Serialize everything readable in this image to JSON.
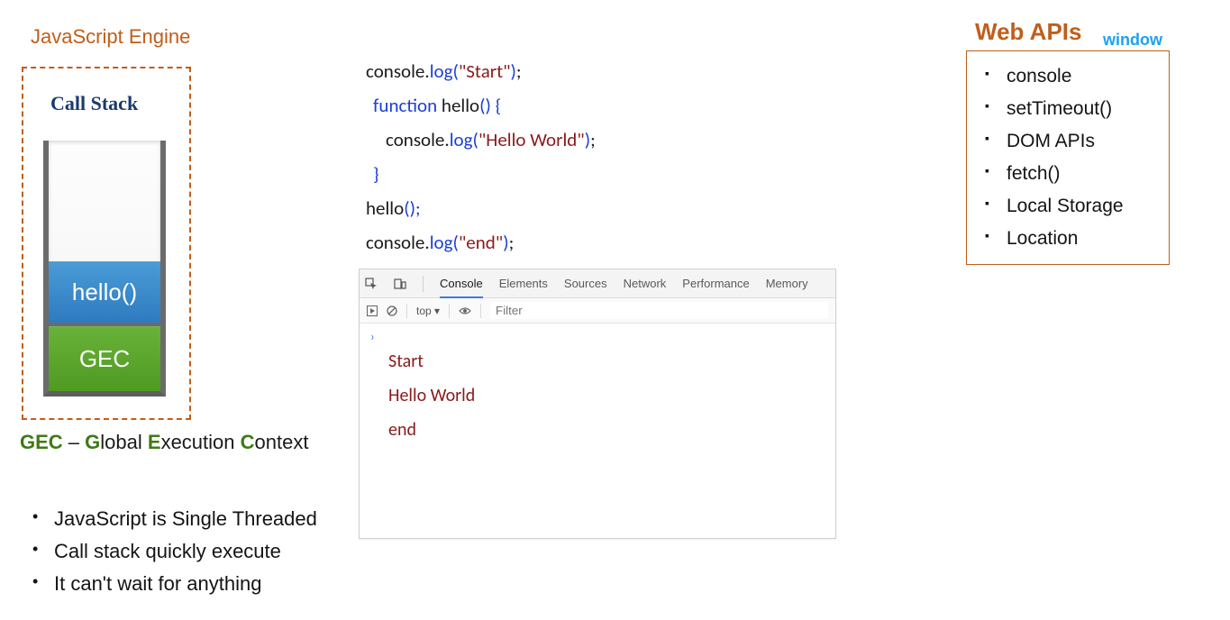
{
  "engine": {
    "title": "JavaScript Engine",
    "callstack_title": "Call Stack",
    "frames": {
      "hello": "hello()",
      "gec": "GEC"
    }
  },
  "gec_caption": {
    "abbr": "GEC",
    "dash": " – ",
    "g": "G",
    "lobal": "lobal ",
    "e": "E",
    "xecution": "xecution ",
    "c": "C",
    "ontext": "ontext"
  },
  "bullets": [
    "JavaScript is Single Threaded",
    "Call stack quickly execute",
    "It can't wait for anything"
  ],
  "code": {
    "l1_a": "console",
    "l1_b": ".",
    "l1_c": "log",
    "l1_d": "(",
    "l1_e": "\"Start\"",
    "l1_f": ")",
    "l1_g": ";",
    "l2_a": "function",
    "l2_b": " hello",
    "l2_c": "() {",
    "l3_a": "console",
    "l3_b": ".",
    "l3_c": "log",
    "l3_d": "(",
    "l3_e": "\"Hello World\"",
    "l3_f": ")",
    "l3_g": ";",
    "l4_a": "}",
    "l5_a": "hello",
    "l5_b": "();",
    "l6_a": "console",
    "l6_b": ".",
    "l6_c": "log",
    "l6_d": "(",
    "l6_e": "\"end\"",
    "l6_f": ")",
    "l6_g": ";"
  },
  "devtools": {
    "tabs": [
      "Console",
      "Elements",
      "Sources",
      "Network",
      "Performance",
      "Memory"
    ],
    "toolbar": {
      "top": "top ▾",
      "filter_placeholder": "Filter"
    },
    "output": [
      "Start",
      "Hello World",
      "end"
    ]
  },
  "webapis": {
    "title": "Web APIs",
    "window": "window",
    "items": [
      "console",
      "setTimeout()",
      "DOM APIs",
      "fetch()",
      "Local Storage",
      "Location"
    ]
  }
}
